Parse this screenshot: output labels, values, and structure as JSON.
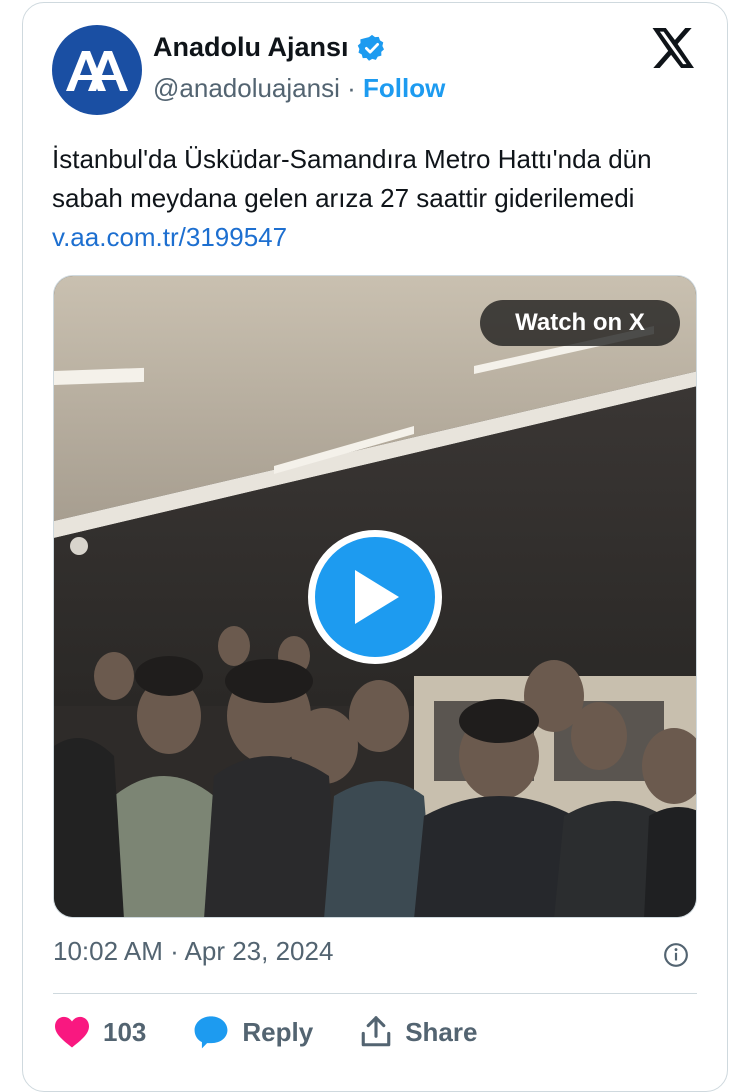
{
  "account": {
    "name": "Anadolu Ajansı",
    "handle": "@anadoluajansi",
    "separator": "·",
    "follow_label": "Follow",
    "avatar_text": "AA"
  },
  "tweet": {
    "text": "İstanbul'da Üsküdar-Samandıra Metro Hattı'nda dün sabah meydana gelen arıza 27 saattir giderilemedi",
    "link": "v.aa.com.tr/3199547"
  },
  "media": {
    "watch_label": "Watch on X"
  },
  "meta": {
    "timestamp": "10:02 AM · Apr 23, 2024"
  },
  "actions": {
    "likes": "103",
    "reply_label": "Reply",
    "share_label": "Share"
  },
  "colors": {
    "accent": "#1d9bf0",
    "link": "#1d6fd0",
    "heart": "#f91880",
    "avatar": "#1a4fa3"
  }
}
